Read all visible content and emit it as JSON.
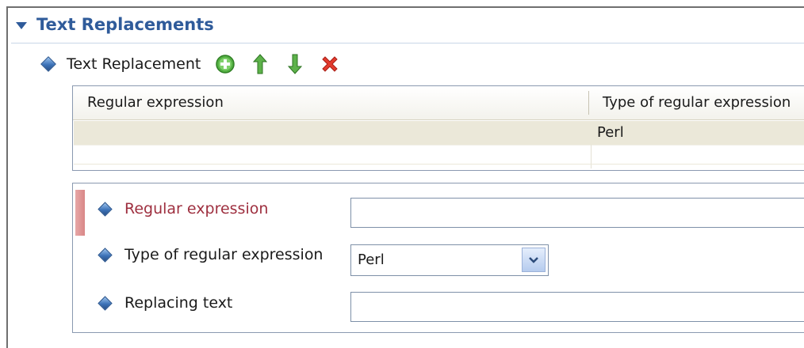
{
  "section": {
    "title": "Text Replacements"
  },
  "toolbar": {
    "label": "Text Replacement",
    "icons": {
      "add": "add-icon",
      "up": "move-up-icon",
      "down": "move-down-icon",
      "delete": "delete-icon"
    }
  },
  "table": {
    "columns": [
      "Regular expression",
      "Type of regular expression"
    ],
    "rows": [
      [
        "",
        "Perl"
      ],
      [
        "",
        ""
      ]
    ]
  },
  "details": {
    "regex_label": "Regular expression",
    "regex_value": "",
    "type_label": "Type of regular expression",
    "type_value": "Perl",
    "replacing_label": "Replacing text",
    "replacing_value": ""
  },
  "colors": {
    "header_blue": "#2f5b9a",
    "required_red": "#9e2f3f",
    "selected_row": "#ebe8d9"
  }
}
